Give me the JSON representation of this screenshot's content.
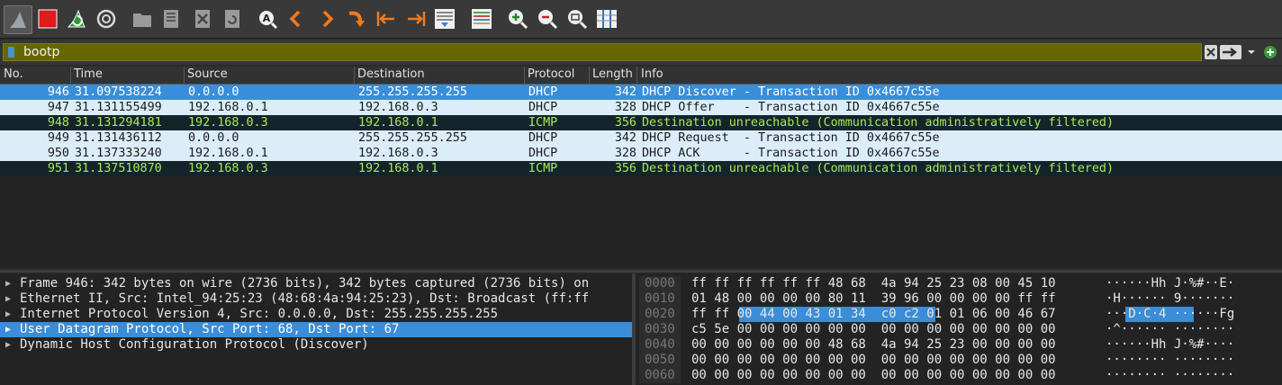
{
  "filter": {
    "value": "bootp"
  },
  "columns": [
    "No.",
    "Time",
    "Source",
    "Destination",
    "Protocol",
    "Length",
    "Info"
  ],
  "packets": [
    {
      "no": "946",
      "time": "31.097538224",
      "src": "0.0.0.0",
      "dst": "255.255.255.255",
      "proto": "DHCP",
      "len": "342",
      "info": "DHCP Discover - Transaction ID 0x4667c55e",
      "style": "selected"
    },
    {
      "no": "947",
      "time": "31.131155499",
      "src": "192.168.0.1",
      "dst": "192.168.0.3",
      "proto": "DHCP",
      "len": "328",
      "info": "DHCP Offer    - Transaction ID 0x4667c55e",
      "style": "light"
    },
    {
      "no": "948",
      "time": "31.131294181",
      "src": "192.168.0.3",
      "dst": "192.168.0.1",
      "proto": "ICMP",
      "len": "356",
      "info": "Destination unreachable (Communication administratively filtered)",
      "style": "dark"
    },
    {
      "no": "949",
      "time": "31.131436112",
      "src": "0.0.0.0",
      "dst": "255.255.255.255",
      "proto": "DHCP",
      "len": "342",
      "info": "DHCP Request  - Transaction ID 0x4667c55e",
      "style": "light"
    },
    {
      "no": "950",
      "time": "31.137333240",
      "src": "192.168.0.1",
      "dst": "192.168.0.3",
      "proto": "DHCP",
      "len": "328",
      "info": "DHCP ACK      - Transaction ID 0x4667c55e",
      "style": "light"
    },
    {
      "no": "951",
      "time": "31.137510870",
      "src": "192.168.0.3",
      "dst": "192.168.0.1",
      "proto": "ICMP",
      "len": "356",
      "info": "Destination unreachable (Communication administratively filtered)",
      "style": "dark"
    }
  ],
  "details": [
    {
      "text": "Frame 946: 342 bytes on wire (2736 bits), 342 bytes captured (2736 bits) on",
      "selected": false
    },
    {
      "text": "Ethernet II, Src: Intel_94:25:23 (48:68:4a:94:25:23), Dst: Broadcast (ff:ff",
      "selected": false
    },
    {
      "text": "Internet Protocol Version 4, Src: 0.0.0.0, Dst: 255.255.255.255",
      "selected": false
    },
    {
      "text": "User Datagram Protocol, Src Port: 68, Dst Port: 67",
      "selected": true
    },
    {
      "text": "Dynamic Host Configuration Protocol (Discover)",
      "selected": false
    }
  ],
  "hex_rows": [
    {
      "offset": "0000",
      "hex": "ff ff ff ff ff ff 48 68  4a 94 25 23 08 00 45 10",
      "ascii": "······Hh J·%#··E·"
    },
    {
      "offset": "0010",
      "hex": "01 48 00 00 00 00 80 11  39 96 00 00 00 00 ff ff",
      "ascii": "·H······ 9·······"
    },
    {
      "offset": "0020",
      "hex": "ff ff 00 44 00 43 01 34  c0 c2 01 01 06 00 46 67",
      "ascii": "···D·C·4 ······Fg"
    },
    {
      "offset": "0030",
      "hex": "c5 5e 00 00 00 00 00 00  00 00 00 00 00 00 00 00",
      "ascii": "·^······ ········"
    },
    {
      "offset": "0040",
      "hex": "00 00 00 00 00 00 48 68  4a 94 25 23 00 00 00 00",
      "ascii": "······Hh J·%#····"
    },
    {
      "offset": "0050",
      "hex": "00 00 00 00 00 00 00 00  00 00 00 00 00 00 00 00",
      "ascii": "········ ········"
    },
    {
      "offset": "0060",
      "hex": "00 00 00 00 00 00 00 00  00 00 00 00 00 00 00 00",
      "ascii": "········ ········"
    }
  ],
  "colors": {
    "selected": "#3a8dd8",
    "filter_bg": "#666600",
    "icmp_text": "#a6e95c"
  },
  "icons": [
    "shark-fin-icon",
    "stop-icon",
    "restart-icon",
    "options-gear-icon",
    "open-folder-icon",
    "save-file-icon",
    "close-file-icon",
    "reload-icon",
    "find-icon",
    "back-arrow-icon",
    "forward-arrow-icon",
    "jump-icon",
    "first-packet-icon",
    "last-packet-icon",
    "autoscroll-icon",
    "colorize-icon",
    "zoom-in-icon",
    "zoom-out-icon",
    "zoom-normal-icon",
    "resize-columns-icon"
  ]
}
